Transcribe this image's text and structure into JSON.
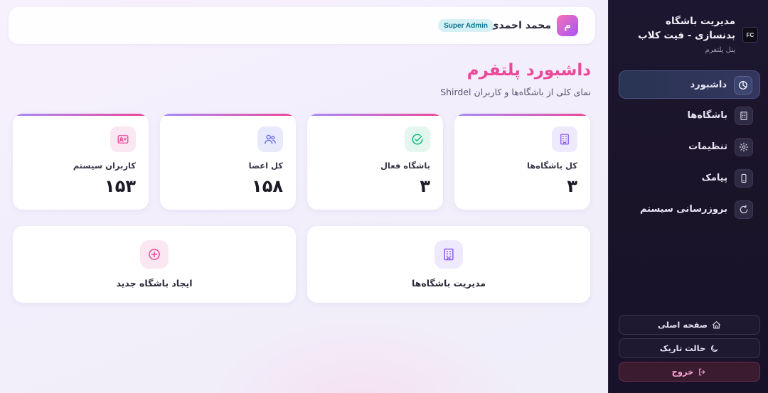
{
  "header": {
    "avatar_initial": "م",
    "user_name": "محمد احمدی",
    "role": "Super Admin"
  },
  "page": {
    "title": "داشبورد پلتفرم",
    "subtitle": "نمای کلی از باشگاه‌ها و کاربران Shirdel"
  },
  "stats": [
    {
      "label": "کل باشگاه‌ها",
      "value": "۳",
      "icon": "building-icon",
      "color": "#8b5cf6",
      "bg": "#efe9fd"
    },
    {
      "label": "باشگاه فعال",
      "value": "۳",
      "icon": "check-circle-icon",
      "color": "#10b981",
      "bg": "#e3f7ef"
    },
    {
      "label": "کل اعضا",
      "value": "۱۵۸",
      "icon": "users-icon",
      "color": "#6366f1",
      "bg": "#e8e9fb"
    },
    {
      "label": "کاربران سیستم",
      "value": "۱۵۳",
      "icon": "id-card-icon",
      "color": "#ec4899",
      "bg": "#fbe7f2"
    }
  ],
  "actions": [
    {
      "label": "مدیریت باشگاه‌ها",
      "icon": "building-icon",
      "color": "#8b5cf6",
      "bg": "#efe9fd"
    },
    {
      "label": "ایجاد باشگاه جدید",
      "icon": "plus-circle-icon",
      "color": "#ec4899",
      "bg": "#fbe7f2"
    }
  ],
  "sidebar": {
    "brand_logo_text": "FC",
    "brand_title": "مدیریت باشگاه بدنسازی - فیت کلاب",
    "brand_subtitle": "پنل پلتفرم",
    "items": [
      {
        "label": "داشبورد",
        "icon": "dashboard-icon",
        "active": true
      },
      {
        "label": "باشگاه‌ها",
        "icon": "building-icon",
        "active": false
      },
      {
        "label": "تنظیمات",
        "icon": "gear-icon",
        "active": false
      },
      {
        "label": "پیامک",
        "icon": "phone-icon",
        "active": false
      },
      {
        "label": "بروزرسانی سیستم",
        "icon": "refresh-icon",
        "active": false
      }
    ],
    "footer": {
      "home": "صفحه اصلی",
      "dark_mode": "حالت تاریک",
      "logout": "خروج"
    }
  },
  "colors": {
    "accent_pink": "#ec4899",
    "accent_purple": "#a855f7",
    "sidebar_bg": "#1d1630",
    "badge_bg": "#d5f1f6",
    "badge_text": "#0e7490"
  }
}
